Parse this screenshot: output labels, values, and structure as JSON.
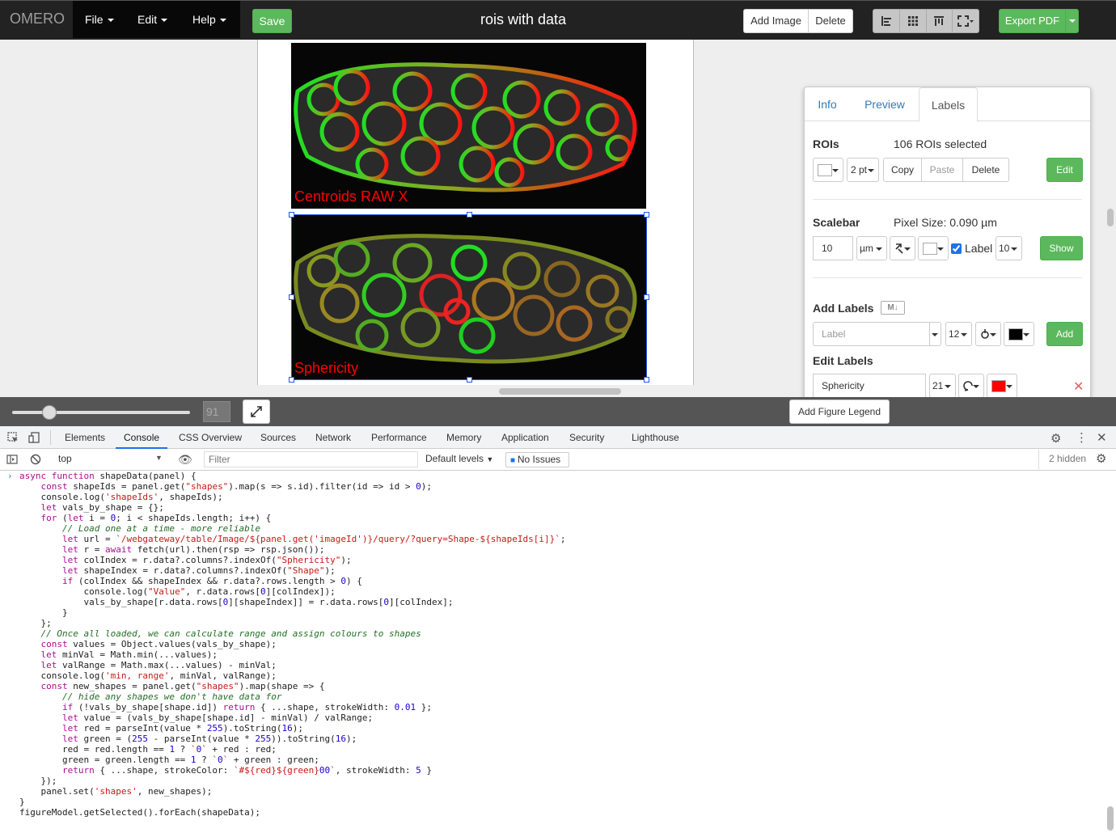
{
  "navbar": {
    "brand": "OMERO",
    "menus": [
      "File",
      "Edit",
      "Help"
    ],
    "save_label": "Save",
    "document_title": "rois with data",
    "add_image_label": "Add Image",
    "delete_label": "Delete",
    "export_label": "Export PDF"
  },
  "figure": {
    "panels": [
      {
        "label": "Centroids RAW X",
        "label_color": "#ff0000"
      },
      {
        "label": "Sphericity",
        "label_color": "#ff0000"
      }
    ],
    "zoom_value": "91",
    "add_legend_label": "Add Figure Legend"
  },
  "properties": {
    "tabs": [
      "Info",
      "Preview",
      "Labels"
    ],
    "active_tab": "Labels",
    "rois": {
      "title": "ROIs",
      "selection_text": "106 ROIs selected",
      "stroke_width": "2 pt",
      "copy_label": "Copy",
      "paste_label": "Paste",
      "delete_label": "Delete",
      "edit_label": "Edit"
    },
    "scalebar": {
      "title": "Scalebar",
      "pixel_size_text": "Pixel Size: 0.090 µm",
      "length_value": "10",
      "unit": "µm",
      "label_checkbox": "Label",
      "label_checked": true,
      "font_size": "10",
      "show_label": "Show"
    },
    "add_labels": {
      "title": "Add Labels",
      "placeholder": "Label",
      "font_size": "12",
      "color": "#000000",
      "add_label": "Add"
    },
    "edit_labels": {
      "title": "Edit Labels",
      "value": "Sphericity",
      "font_size": "21",
      "color": "#ff0000",
      "remove_icon": "close-icon"
    }
  },
  "devtools": {
    "tabs": [
      "Elements",
      "Console",
      "CSS Overview",
      "Sources",
      "Network",
      "Performance",
      "Memory",
      "Application",
      "Security",
      "Lighthouse"
    ],
    "active_tab": "Console",
    "context": "top",
    "filter_placeholder": "Filter",
    "levels": "Default levels",
    "issues": "No Issues",
    "hidden_count": "2 hidden",
    "code_lines": [
      "async function shapeData(panel) {",
      "    const shapeIds = panel.get(\"shapes\").map(s => s.id).filter(id => id > 0);",
      "    console.log('shapeIds', shapeIds);",
      "    let vals_by_shape = {};",
      "    for (let i = 0; i < shapeIds.length; i++) {",
      "        // Load one at a time - more reliable",
      "        let url = `/webgateway/table/Image/${panel.get('imageId')}/query/?query=Shape-${shapeIds[i]}`;",
      "        let r = await fetch(url).then(rsp => rsp.json());",
      "        let colIndex = r.data?.columns?.indexOf(\"Sphericity\");",
      "        let shapeIndex = r.data?.columns?.indexOf(\"Shape\");",
      "        if (colIndex && shapeIndex && r.data?.rows.length > 0) {",
      "            console.log(\"Value\", r.data.rows[0][colIndex]);",
      "            vals_by_shape[r.data.rows[0][shapeIndex]] = r.data.rows[0][colIndex];",
      "        }",
      "    };",
      "    // Once all loaded, we can calculate range and assign colours to shapes",
      "    const values = Object.values(vals_by_shape);",
      "    let minVal = Math.min(...values);",
      "    let valRange = Math.max(...values) - minVal;",
      "    console.log('min, range', minVal, valRange);",
      "    const new_shapes = panel.get(\"shapes\").map(shape => {",
      "        // hide any shapes we don't have data for",
      "        if (!vals_by_shape[shape.id]) return { ...shape, strokeWidth: 0.01 };",
      "        let value = (vals_by_shape[shape.id] - minVal) / valRange;",
      "        let red = parseInt(value * 255).toString(16);",
      "        let green = (255 - parseInt(value * 255)).toString(16);",
      "        red = red.length == 1 ? `0` + red : red;",
      "        green = green.length == 1 ? `0` + green : green;",
      "        return { ...shape, strokeColor: `#${red}${green}00`, strokeWidth: 5 }",
      "    });",
      "    panel.set('shapes', new_shapes);",
      "}",
      "figureModel.getSelected().forEach(shapeData);"
    ]
  }
}
